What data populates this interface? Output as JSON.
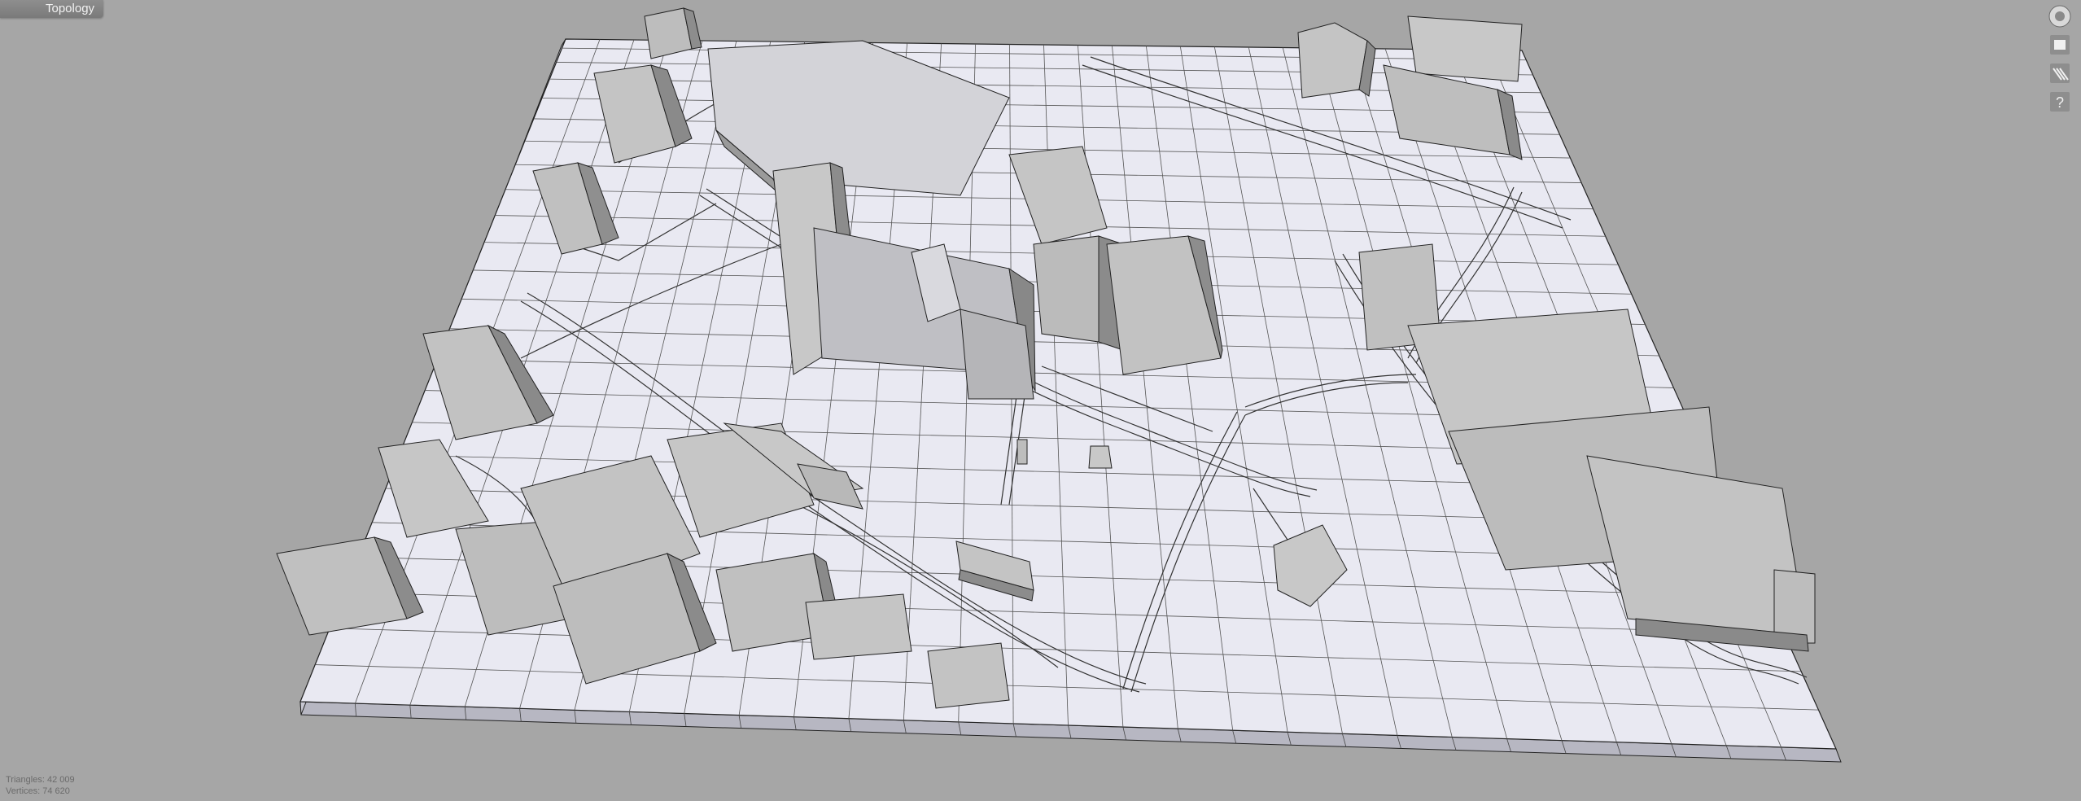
{
  "window": {
    "title": "Topology"
  },
  "toolbar": {
    "buttons": [
      {
        "icon": "navigation-cube-icon"
      },
      {
        "icon": "display-mode-icon"
      },
      {
        "icon": "hatch-pattern-icon"
      },
      {
        "icon": "help-icon",
        "glyph": "?"
      }
    ]
  },
  "stats": {
    "triangles": "Triangles: 42 009",
    "vertices": "Vertices: 74 620"
  }
}
